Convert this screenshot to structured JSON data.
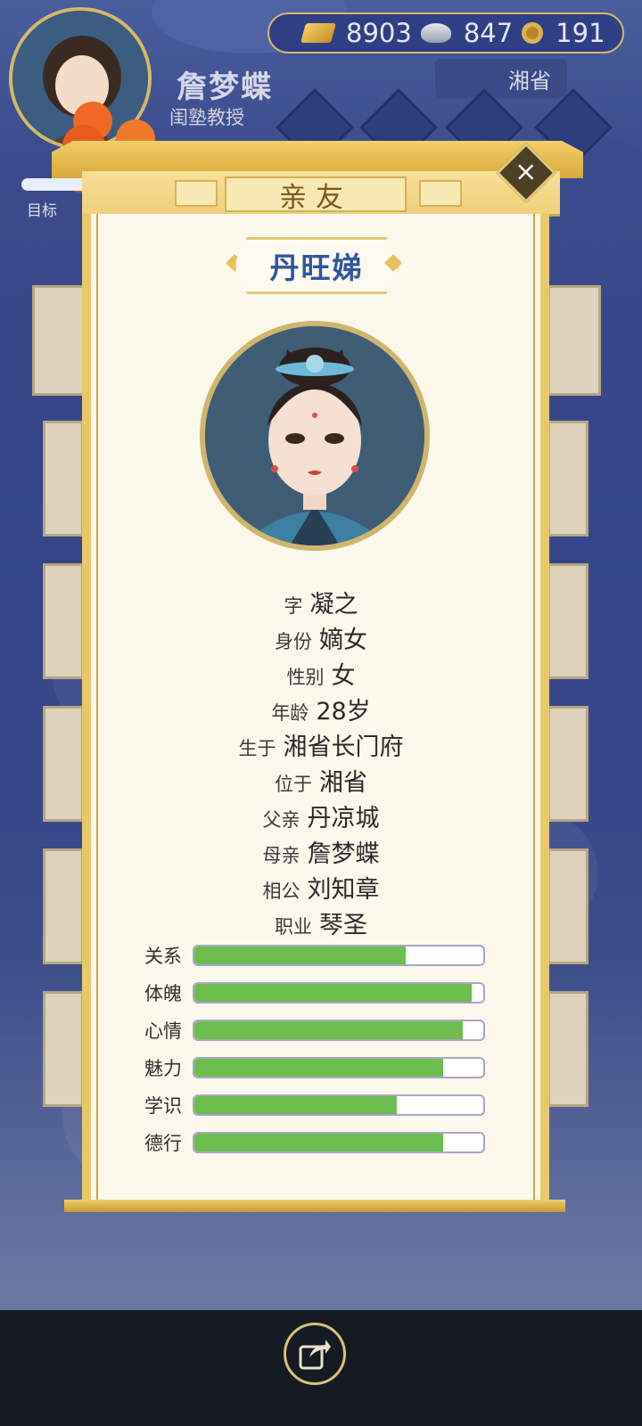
{
  "currency": {
    "gold": "8903",
    "silver": "847",
    "copper": "191"
  },
  "player": {
    "name": "詹梦蝶",
    "title": "闺塾教授",
    "location": "湘省"
  },
  "goal_label": "目标",
  "dialog": {
    "title": "亲友",
    "close_icon": "close-icon",
    "person_name": "丹旺娣",
    "info": [
      {
        "label": "字",
        "value": "凝之"
      },
      {
        "label": "身份",
        "value": "嫡女"
      },
      {
        "label": "性别",
        "value": "女"
      },
      {
        "label": "年龄",
        "value": "28岁"
      },
      {
        "label": "生于",
        "value": "湘省长门府"
      },
      {
        "label": "位于",
        "value": "湘省"
      },
      {
        "label": "父亲",
        "value": "丹凉城"
      },
      {
        "label": "母亲",
        "value": "詹梦蝶"
      },
      {
        "label": "相公",
        "value": "刘知章"
      },
      {
        "label": "职业",
        "value": "琴圣"
      }
    ],
    "stats": [
      {
        "label": "关系",
        "value": 73
      },
      {
        "label": "体魄",
        "value": 96
      },
      {
        "label": "心情",
        "value": 93
      },
      {
        "label": "魅力",
        "value": 86
      },
      {
        "label": "学识",
        "value": 70
      },
      {
        "label": "德行",
        "value": 86
      }
    ]
  },
  "colors": {
    "stat_fill": "#6dbd4f",
    "name_blue": "#2f55a2",
    "gold_trim": "#e8c86a"
  },
  "bottom": {
    "share_icon": "share-icon"
  }
}
